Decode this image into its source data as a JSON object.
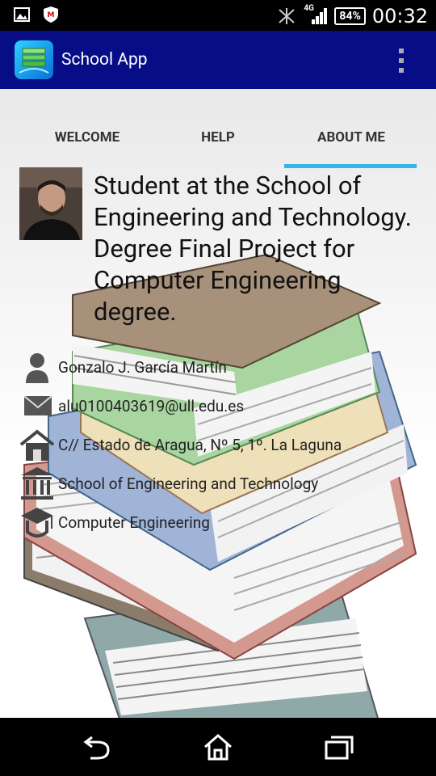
{
  "status_bar": {
    "network": "4G",
    "battery": "84%",
    "time": "00:32"
  },
  "app_bar": {
    "title": "School App"
  },
  "tabs": [
    {
      "label": "WELCOME"
    },
    {
      "label": "HELP"
    },
    {
      "label": "ABOUT ME"
    }
  ],
  "profile": {
    "headline": "Student at the School of Engineering and Technology. Degree Final Project for Computer Engineering degree.",
    "name": "Gonzalo J. García Martín",
    "email": "alu0100403619@ull.edu.es",
    "address": "C// Estado de Aragua, Nº 5, 1º. La Laguna",
    "school": "School of Engineering and Technology",
    "degree": "Computer Engineering"
  },
  "colors": {
    "action_bar": "#070d86",
    "tab_indicator": "#33b5e5"
  }
}
